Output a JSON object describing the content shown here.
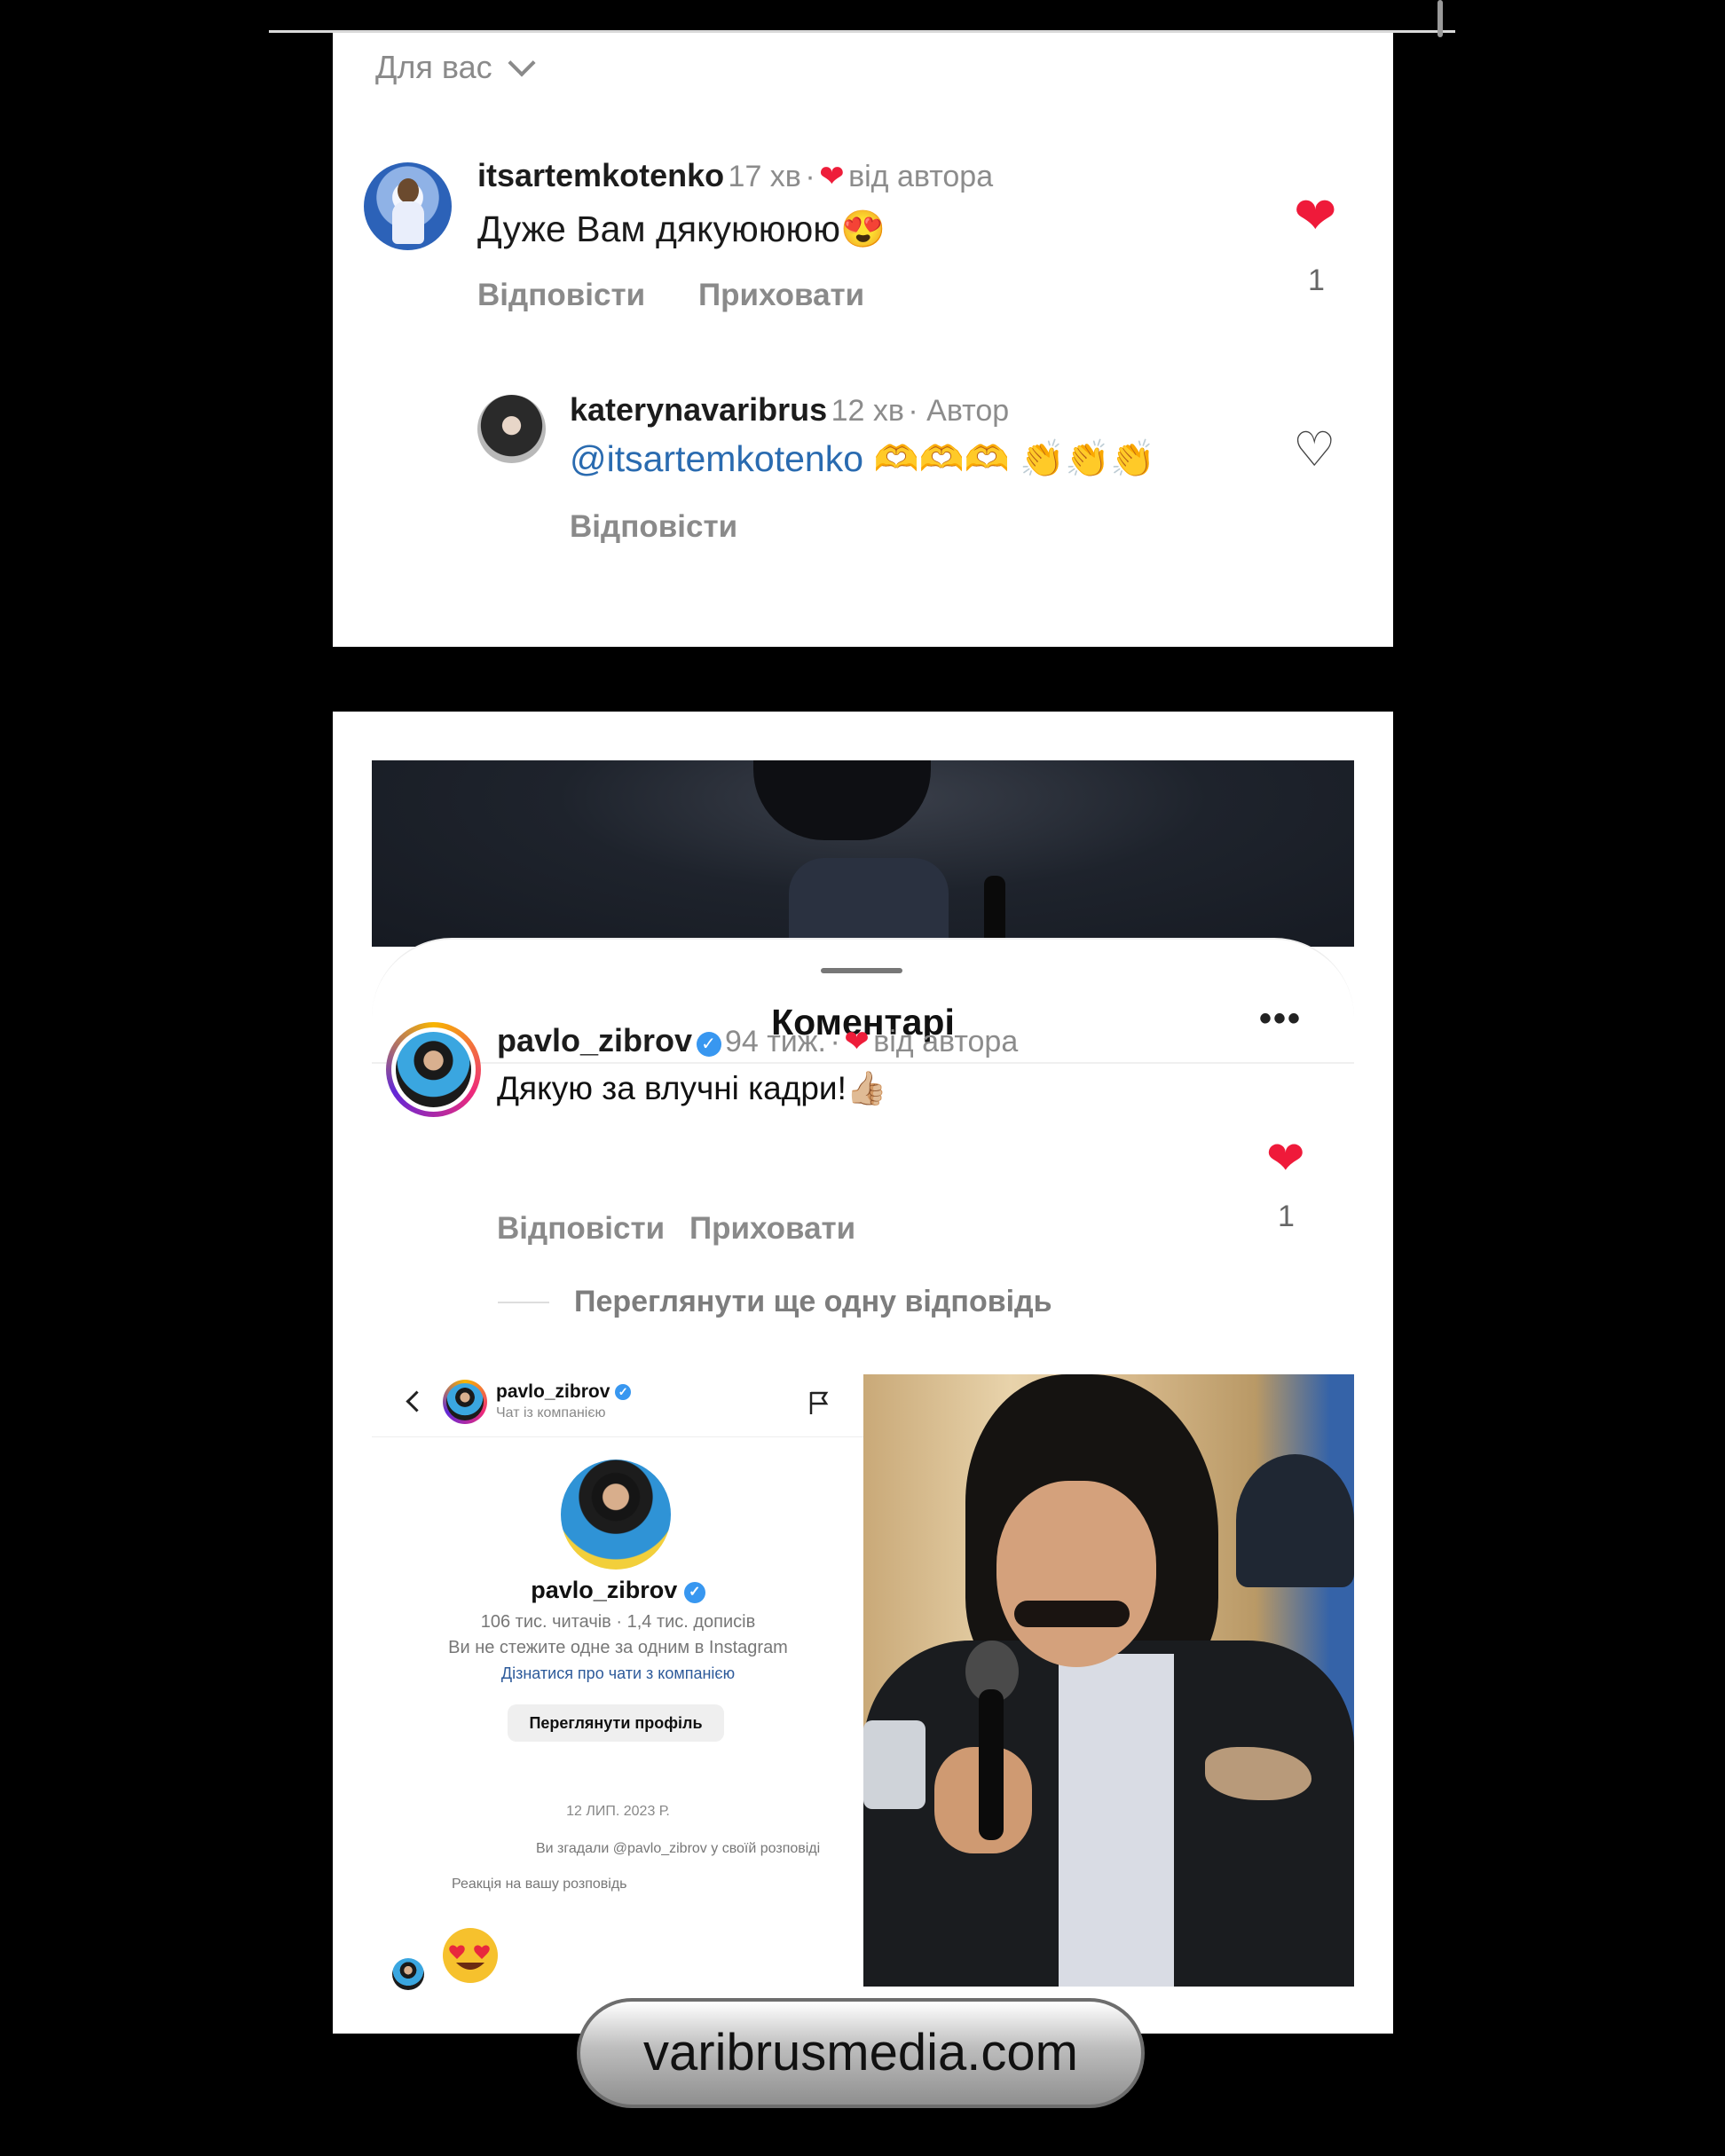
{
  "panel1": {
    "filter_label": "Для вас",
    "comment1": {
      "username": "itsartemkotenko",
      "time": "17 хв",
      "sep": "·",
      "from_author": "від автора",
      "text": "Дуже Вам дякуюююю",
      "emoji": "😍",
      "reply": "Відповісти",
      "hide": "Приховати",
      "likes": "1"
    },
    "comment2": {
      "username": "katerynavaribrus",
      "time": "12 хв",
      "author_tag": "· Автор",
      "mention": "@itsartemkotenko",
      "emojis": "🫶🫶🫶 👏👏👏",
      "reply": "Відповісти"
    }
  },
  "panel2": {
    "sheet_title": "Коментарі",
    "more_menu": "•••",
    "comment": {
      "username": "pavlo_zibrov",
      "time": "94 тиж.",
      "sep": "·",
      "from_author": "від автора",
      "text": "Дякую за влучні кадри!",
      "emoji": "👍🏼",
      "reply": "Відповісти",
      "hide": "Приховати",
      "likes": "1",
      "view_more": "Переглянути ще одну відповідь"
    },
    "chat": {
      "username": "pavlo_zibrov",
      "subtitle": "Чат із компанією",
      "profile_name": "pavlo_zibrov",
      "stats": "106 тис. читачів · 1,4 тис. дописів",
      "follow_note": "Ви не стежите одне за одним в Instagram",
      "learn_link": "Дізнатися про чати з компанією",
      "view_profile": "Переглянути профіль",
      "date": "12 ЛИП. 2023 Р.",
      "mention_note": "Ви згадали @pavlo_zibrov у своїй розповіді",
      "reaction_note": "Реакція на вашу розповідь"
    }
  },
  "watermark": "varibrusmedia.com",
  "colors": {
    "like_red": "#ee1d3a",
    "mention_blue": "#2a6bb0",
    "verified_blue": "#3897f0"
  }
}
